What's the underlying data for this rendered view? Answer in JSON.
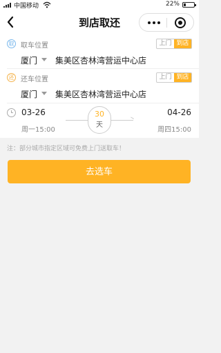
{
  "status_bar": {
    "carrier": "中国移动",
    "battery": "22%",
    "battery_level": 0.22
  },
  "nav": {
    "title": "到店取还"
  },
  "pickup": {
    "icon": "取",
    "label": "取车位置",
    "city": "厦门",
    "store": "集美区杏林湾营运中心店",
    "toggle": {
      "door": "上门",
      "store": "到店",
      "selected": "到店"
    }
  },
  "return": {
    "icon": "还",
    "label": "还车位置",
    "city": "厦门",
    "store": "集美区杏林湾营运中心店",
    "toggle": {
      "door": "上门",
      "store": "到店",
      "selected": "到店"
    }
  },
  "dates": {
    "start_date": "03-26",
    "start_time": "周一15:00",
    "end_date": "04-26",
    "end_time": "周四15:00",
    "days": "30",
    "days_unit": "天"
  },
  "note": "注：部分城市指定区域可免费上门送取车！",
  "submit_label": "去选车",
  "colors": {
    "accent": "#ffb324",
    "pickup_icon": "#7ab8ec",
    "return_icon": "#f4b34c"
  }
}
